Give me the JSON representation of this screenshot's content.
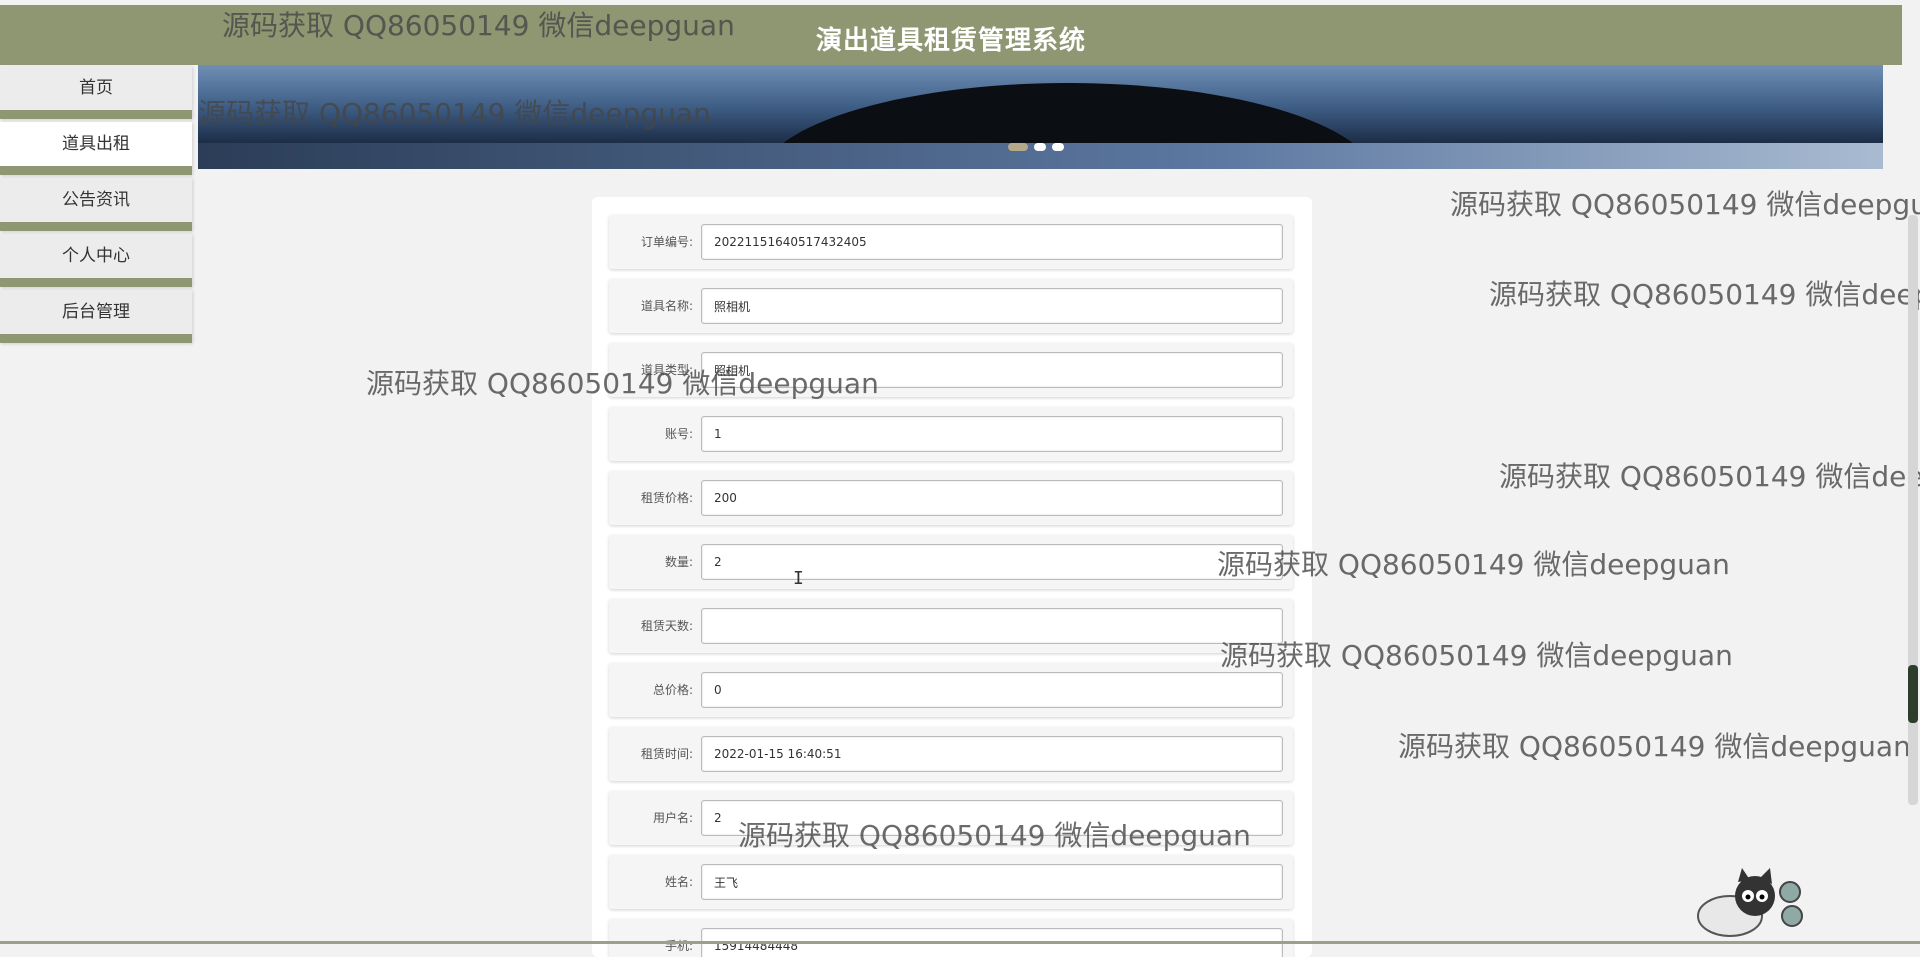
{
  "header": {
    "title": "演出道具租赁管理系统"
  },
  "nav": [
    {
      "label": "首页"
    },
    {
      "label": "道具出租"
    },
    {
      "label": "公告资讯"
    },
    {
      "label": "个人中心"
    },
    {
      "label": "后台管理"
    }
  ],
  "nav_active_index": 1,
  "banner": {
    "slides": 3,
    "active_slide": 0
  },
  "form": {
    "fields": [
      {
        "label": "订单编号:",
        "value": "20221151640517432405"
      },
      {
        "label": "道具名称:",
        "value": "照相机"
      },
      {
        "label": "道具类型:",
        "value": "照相机"
      },
      {
        "label": "账号:",
        "value": "1"
      },
      {
        "label": "租赁价格:",
        "value": "200"
      },
      {
        "label": "数量:",
        "value": "2"
      },
      {
        "label": "租赁天数:",
        "value": ""
      },
      {
        "label": "总价格:",
        "value": "0"
      },
      {
        "label": "租赁时间:",
        "value": "2022-01-15 16:40:51"
      },
      {
        "label": "用户名:",
        "value": "2"
      },
      {
        "label": "姓名:",
        "value": "王飞"
      },
      {
        "label": "手机:",
        "value": "15914484448"
      }
    ]
  },
  "watermark": {
    "text": "源码获取 QQ86050149 微信deepguan"
  },
  "colors": {
    "accent": "#8e9672",
    "background": "#f2f2f2"
  }
}
